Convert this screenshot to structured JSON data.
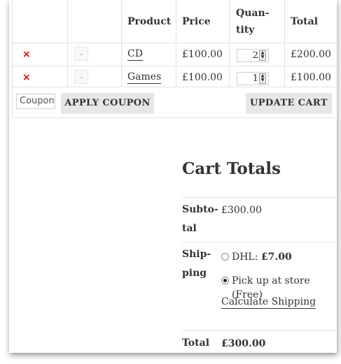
{
  "cart": {
    "headers": {
      "product": "Product",
      "price": "Price",
      "quantity_line1": "Quan-",
      "quantity_line2": "tity",
      "total": "Total"
    },
    "items": [
      {
        "remove": "×",
        "name": "CD",
        "price": "£100.00",
        "quantity": "2",
        "total": "£200.00"
      },
      {
        "remove": "×",
        "name": "Games",
        "price": "£100.00",
        "quantity": "1",
        "total": "£100.00"
      }
    ],
    "coupon_placeholder": "Coupon code",
    "apply_coupon_label": "APPLY COUPON",
    "update_cart_label": "UPDATE CART"
  },
  "totals": {
    "title": "Cart Totals",
    "subtotal_label_1": "Subto-",
    "subtotal_label_2": "tal",
    "subtotal_value": "£300.00",
    "shipping_label_1": "Ship-",
    "shipping_label_2": "ping",
    "shipping_options": [
      {
        "label": "DHL: ",
        "price": "£7.00",
        "selected": false
      },
      {
        "label": "Pick up at store (Free)",
        "price": "",
        "selected": true
      }
    ],
    "calculate_shipping": "Calculate Shipping",
    "total_label": "Total",
    "total_value": "£300.00"
  },
  "colors": {
    "remove": "#e00000",
    "button_bg": "#e7e7e7",
    "border": "#e3e3e3"
  }
}
